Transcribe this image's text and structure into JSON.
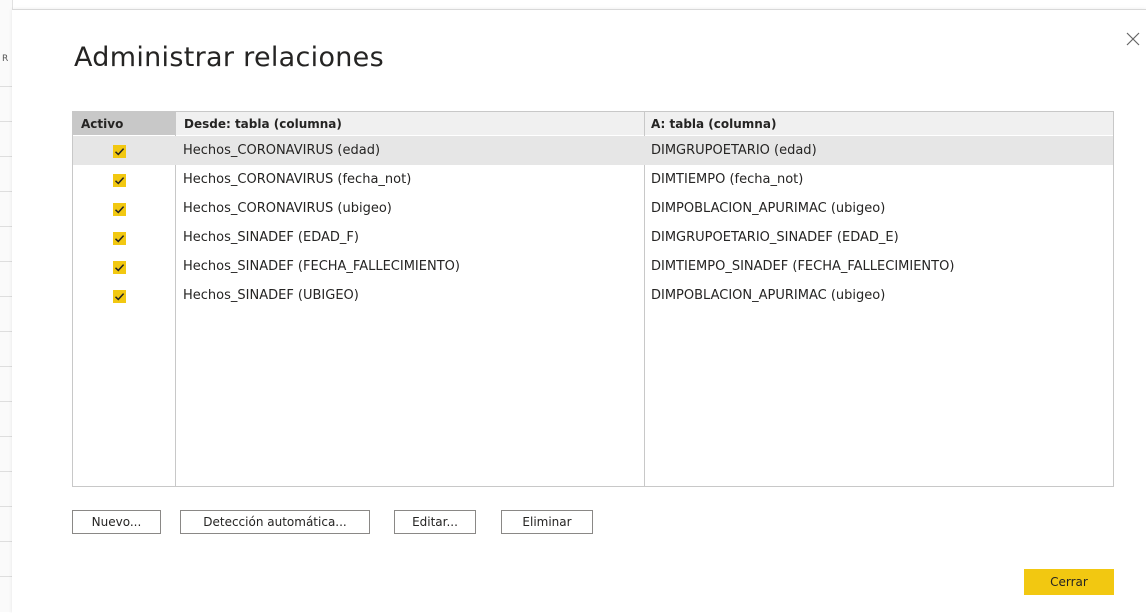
{
  "dialog": {
    "title": "Administrar relaciones",
    "close_icon": "close-icon"
  },
  "table": {
    "headers": {
      "active": "Activo",
      "from": "Desde: tabla (columna)",
      "to": "A: tabla (columna)"
    },
    "rows": [
      {
        "active": true,
        "from": "Hechos_CORONAVIRUS (edad)",
        "to": "DIMGRUPOETARIO (edad)",
        "selected": true
      },
      {
        "active": true,
        "from": "Hechos_CORONAVIRUS (fecha_not)",
        "to": "DIMTIEMPO (fecha_not)",
        "selected": false
      },
      {
        "active": true,
        "from": "Hechos_CORONAVIRUS (ubigeo)",
        "to": "DIMPOBLACION_APURIMAC (ubigeo)",
        "selected": false
      },
      {
        "active": true,
        "from": "Hechos_SINADEF (EDAD_F)",
        "to": "DIMGRUPOETARIO_SINADEF (EDAD_E)",
        "selected": false
      },
      {
        "active": true,
        "from": "Hechos_SINADEF (FECHA_FALLECIMIENTO)",
        "to": "DIMTIEMPO_SINADEF (FECHA_FALLECIMIENTO)",
        "selected": false
      },
      {
        "active": true,
        "from": "Hechos_SINADEF (UBIGEO)",
        "to": "DIMPOBLACION_APURIMAC (ubigeo)",
        "selected": false
      }
    ]
  },
  "buttons": {
    "new": "Nuevo...",
    "autodetect": "Detección automática...",
    "edit": "Editar...",
    "delete": "Eliminar",
    "close": "Cerrar"
  },
  "colors": {
    "accent": "#F2C811",
    "selected_row": "#E6E6E6",
    "header_active_bg": "#C8C8C8",
    "header_bg": "#F0F0F0"
  },
  "background_edge_text": "R"
}
